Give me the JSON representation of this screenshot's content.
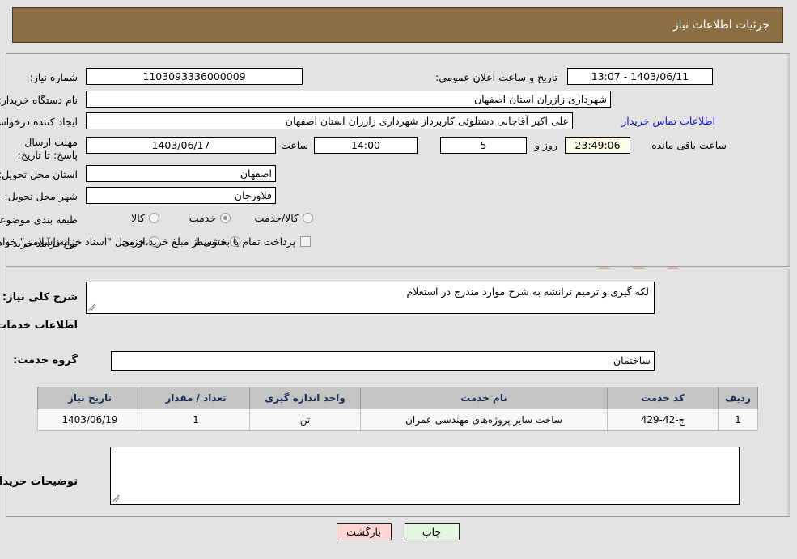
{
  "header": {
    "title": "جزئیات اطلاعات نیاز"
  },
  "colors": {
    "header_bar": "#8b6f43",
    "header_text": "#ffffff",
    "page_bg": "#e3e3e3",
    "link": "#1414e0",
    "timer_bg": "#fbfbe8",
    "table_header_bg": "#c4c4c4",
    "table_header_text": "#1d2a52",
    "table_row_bg": "#f7f7f7",
    "button_back_bg": "#ffd4d4",
    "button_print_bg": "#e4f5e0"
  },
  "watermark": {
    "text": "AriaTender.net",
    "logo": "shield-logo"
  },
  "top_form": {
    "need_number": {
      "label": "شماره نیاز:",
      "value": "1103093336000009"
    },
    "announce_datetime": {
      "label": "تاریخ و ساعت اعلان عمومی:",
      "value": "1403/06/11 - 13:07"
    },
    "buyer_org": {
      "label": "نام دستگاه خریدار:",
      "value": "شهرداری زازران استان اصفهان"
    },
    "requester": {
      "label": "ایجاد کننده درخواست:",
      "value": "علی اکبر آقاجانی دشتلوئی کاربرداز شهرداری زازران استان اصفهان",
      "contact_link": "اطلاعات تماس خریدار"
    },
    "deadline": {
      "label": "مهلت ارسال پاسخ: تا تاریخ:",
      "date": "1403/06/17",
      "hour_label": "ساعت",
      "hour": "14:00",
      "days": "5",
      "days_label": "روز و",
      "countdown": "23:49:06",
      "remaining_label": "ساعت باقی مانده"
    },
    "delivery_province": {
      "label": "استان محل تحویل:",
      "value": "اصفهان"
    },
    "delivery_city": {
      "label": "شهر محل تحویل:",
      "value": "فلاورجان"
    },
    "category": {
      "label": "طبقه بندی موضوعی:",
      "options": [
        {
          "label": "کالا",
          "selected": false
        },
        {
          "label": "خدمت",
          "selected": true
        },
        {
          "label": "کالا/خدمت",
          "selected": false
        }
      ]
    },
    "purchase_type": {
      "label": "نوع فرآیند خرید :",
      "options": [
        {
          "label": "جزیی",
          "selected": false
        },
        {
          "label": "متوسط",
          "selected": true
        }
      ],
      "treasury_note": "پرداخت تمام یا بخشی از مبلغ خرید،از محل \"اسناد خزانه اسلامی\" خواهد بود.",
      "treasury_checked": false
    }
  },
  "mid_form": {
    "summary": {
      "label": "شرح کلی نیاز:",
      "value": "لکه گیری و ترمیم ترانشه  به شرح موارد مندرج در استعلام"
    },
    "services_heading": "اطلاعات خدمات مورد نیاز",
    "service_group": {
      "label": "گروه خدمت:",
      "value": "ساختمان"
    },
    "table": {
      "columns": [
        "ردیف",
        "کد خدمت",
        "نام خدمت",
        "واحد اندازه گیری",
        "تعداد / مقدار",
        "تاریخ نیاز"
      ],
      "rows": [
        [
          "1",
          "ج-42-429",
          "ساخت سایر پروژه‌های مهندسی عمران",
          "تن",
          "1",
          "1403/06/19"
        ]
      ]
    },
    "buyer_notes": {
      "label": "توضیحات خریدار:",
      "value": ""
    }
  },
  "footer": {
    "back_button": "بازگشت",
    "print_button": "چاپ"
  }
}
